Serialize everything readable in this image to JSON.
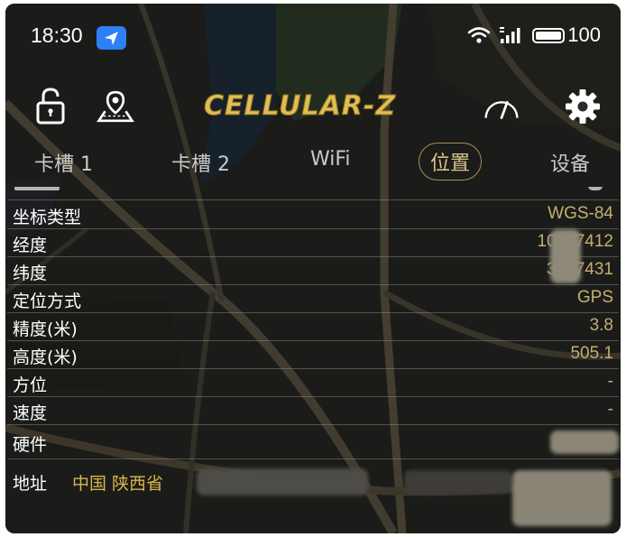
{
  "status_bar": {
    "time": "18:30",
    "battery_level": "100"
  },
  "header": {
    "logo_text": "CELLULAR-Z"
  },
  "tabs": [
    {
      "label": "卡槽 1"
    },
    {
      "label": "卡槽 2"
    },
    {
      "label": "WiFi"
    },
    {
      "label": "位置"
    },
    {
      "label": "设备"
    }
  ],
  "location": {
    "rows": [
      {
        "label": "坐标类型",
        "value": "WGS-84"
      },
      {
        "label": "经度",
        "value": "107.  7412"
      },
      {
        "label": "纬度",
        "value": "33.  7431"
      },
      {
        "label": "定位方式",
        "value": "GPS"
      },
      {
        "label": "精度(米)",
        "value": "3.8"
      },
      {
        "label": "高度(米)",
        "value": "505.1"
      },
      {
        "label": "方位",
        "value": "-"
      },
      {
        "label": "速度",
        "value": "-"
      },
      {
        "label": "硬件",
        "value": ""
      }
    ],
    "address": {
      "label": "地址",
      "value": "中国 陕西省"
    }
  },
  "colors": {
    "accent_gold": "#c5ae73",
    "tab_active": "#d8c48a",
    "location_badge": "#2f7ff5"
  }
}
